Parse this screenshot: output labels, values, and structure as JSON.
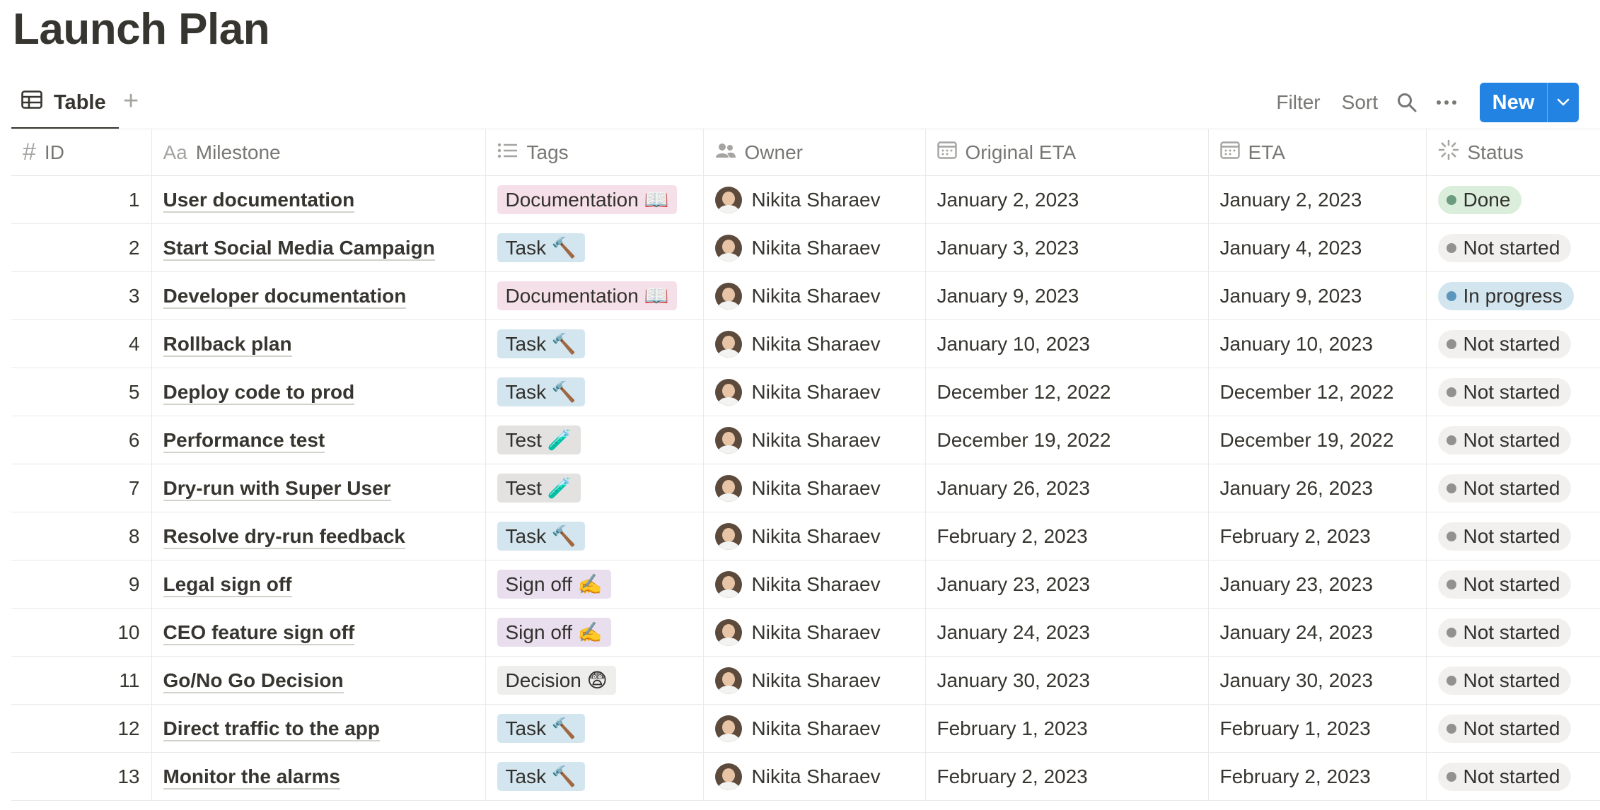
{
  "page": {
    "title": "Launch Plan"
  },
  "view": {
    "tab_label": "Table",
    "add_symbol": "+"
  },
  "toolbar": {
    "filter_label": "Filter",
    "sort_label": "Sort",
    "new_label": "New"
  },
  "columns": {
    "id": "ID",
    "milestone": "Milestone",
    "tags": "Tags",
    "owner": "Owner",
    "original_eta": "Original ETA",
    "eta": "ETA",
    "status": "Status"
  },
  "column_icons": {
    "id": "hash-icon",
    "milestone": "text-icon",
    "tags": "list-icon",
    "owner": "people-icon",
    "original_eta": "calendar-icon",
    "eta": "calendar-icon",
    "status": "status-spinner-icon"
  },
  "id_icon_text": "#",
  "milestone_icon_text": "Aa",
  "tag_styles": {
    "Documentation 📖": "#f5e0e9",
    "Task 🔨": "#d3e5ef",
    "Test 🧪": "#e3e2e0",
    "Sign off ✍️": "#e8deee",
    "Decision 😨": "#eeeeed"
  },
  "status_styles": {
    "Done": {
      "bg": "#dbeddb",
      "dot": "#6c9b7d"
    },
    "Not started": {
      "bg": "#e3e2e080",
      "dot": "#91918e"
    },
    "In progress": {
      "bg": "#d3e5ef",
      "dot": "#5b97bd"
    }
  },
  "rows": [
    {
      "id": "1",
      "milestone": "User documentation",
      "tag": "Documentation 📖",
      "owner": "Nikita Sharaev",
      "original_eta": "January 2, 2023",
      "eta": "January 2, 2023",
      "status": "Done"
    },
    {
      "id": "2",
      "milestone": "Start Social Media Campaign",
      "tag": "Task 🔨",
      "owner": "Nikita Sharaev",
      "original_eta": "January 3, 2023",
      "eta": "January 4, 2023",
      "status": "Not started"
    },
    {
      "id": "3",
      "milestone": "Developer documentation",
      "tag": "Documentation 📖",
      "owner": "Nikita Sharaev",
      "original_eta": "January 9, 2023",
      "eta": "January 9, 2023",
      "status": "In progress"
    },
    {
      "id": "4",
      "milestone": "Rollback plan",
      "tag": "Task 🔨",
      "owner": "Nikita Sharaev",
      "original_eta": "January 10, 2023",
      "eta": "January 10, 2023",
      "status": "Not started"
    },
    {
      "id": "5",
      "milestone": "Deploy code to prod",
      "tag": "Task 🔨",
      "owner": "Nikita Sharaev",
      "original_eta": "December 12, 2022",
      "eta": "December 12, 2022",
      "status": "Not started"
    },
    {
      "id": "6",
      "milestone": "Performance test",
      "tag": "Test 🧪",
      "owner": "Nikita Sharaev",
      "original_eta": "December 19, 2022",
      "eta": "December 19, 2022",
      "status": "Not started"
    },
    {
      "id": "7",
      "milestone": "Dry-run with Super User",
      "tag": "Test 🧪",
      "owner": "Nikita Sharaev",
      "original_eta": "January 26, 2023",
      "eta": "January 26, 2023",
      "status": "Not started"
    },
    {
      "id": "8",
      "milestone": "Resolve dry-run feedback",
      "tag": "Task 🔨",
      "owner": "Nikita Sharaev",
      "original_eta": "February 2, 2023",
      "eta": "February 2, 2023",
      "status": "Not started"
    },
    {
      "id": "9",
      "milestone": "Legal sign off",
      "tag": "Sign off ✍️",
      "owner": "Nikita Sharaev",
      "original_eta": "January 23, 2023",
      "eta": "January 23, 2023",
      "status": "Not started"
    },
    {
      "id": "10",
      "milestone": "CEO feature sign off",
      "tag": "Sign off ✍️",
      "owner": "Nikita Sharaev",
      "original_eta": "January 24, 2023",
      "eta": "January 24, 2023",
      "status": "Not started"
    },
    {
      "id": "11",
      "milestone": "Go/No Go Decision",
      "tag": "Decision 😨",
      "owner": "Nikita Sharaev",
      "original_eta": "January 30, 2023",
      "eta": "January 30, 2023",
      "status": "Not started"
    },
    {
      "id": "12",
      "milestone": "Direct traffic to the app",
      "tag": "Task 🔨",
      "owner": "Nikita Sharaev",
      "original_eta": "February 1, 2023",
      "eta": "February 1, 2023",
      "status": "Not started"
    },
    {
      "id": "13",
      "milestone": "Monitor the alarms",
      "tag": "Task 🔨",
      "owner": "Nikita Sharaev",
      "original_eta": "February 2, 2023",
      "eta": "February 2, 2023",
      "status": "Not started"
    }
  ]
}
